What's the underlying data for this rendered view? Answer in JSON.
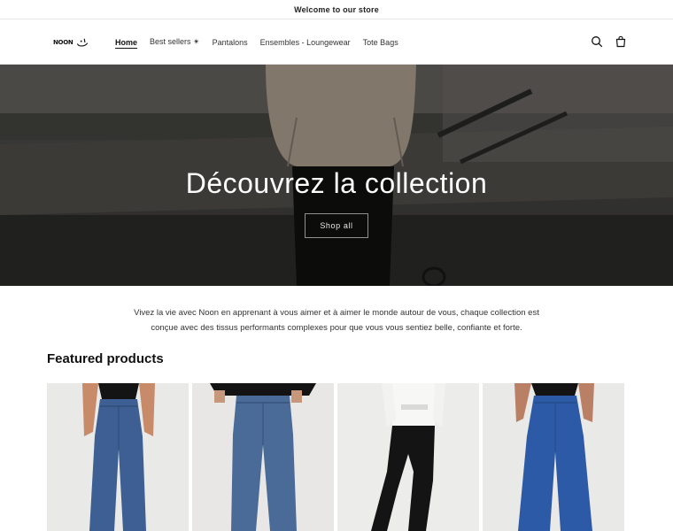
{
  "announcement": "Welcome to our store",
  "header": {
    "logo_text": "NOON",
    "nav": [
      "Home",
      "Best sellers ✴",
      "Pantalons",
      "Ensembles - Loungewear",
      "Tote Bags"
    ],
    "search_icon": "search-icon",
    "cart_icon": "cart-icon"
  },
  "hero": {
    "title": "Découvrez la collection",
    "button": "Shop all"
  },
  "intro": "Vivez la vie avec Noon en apprenant à vous aimer et à aimer le monde autour de vous, chaque collection est conçue avec des tissus performants complexes pour que vous vous sentiez belle, confiante et forte.",
  "featured": {
    "heading": "Featured products"
  },
  "colors": {
    "accent": "#121212",
    "hero_overlay": "#3a3a38",
    "denim": "#3c5f95",
    "black_pants": "#151515"
  }
}
